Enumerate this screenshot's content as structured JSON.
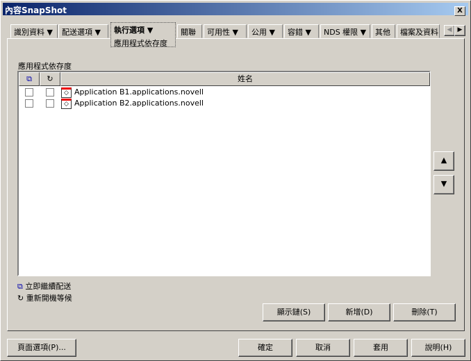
{
  "window": {
    "title": "內容SnapShot",
    "close": "X"
  },
  "tabs": [
    {
      "label": "識別資料 ▼"
    },
    {
      "label": "配送選項 ▼"
    },
    {
      "label": "執行選項",
      "sub": "應用程式依存度"
    },
    {
      "label": "關聯"
    },
    {
      "label": "可用性 ▼"
    },
    {
      "label": "公用 ▼"
    },
    {
      "label": "容錯 ▼"
    },
    {
      "label": "NDS 權限 ▼"
    },
    {
      "label": "其他"
    },
    {
      "label": "檔案及資料"
    }
  ],
  "section_label": "應用程式依存度",
  "list": {
    "column_name": "姓名",
    "rows": [
      {
        "name": "Application B1.applications.novell"
      },
      {
        "name": "Application B2.applications.novell"
      }
    ]
  },
  "legend": {
    "immediate": "立即繼續配送",
    "reboot": "重新開機等候"
  },
  "buttons": {
    "show_chain": "顯示鏈(S)",
    "add": "新增(D)",
    "delete": "刪除(T)",
    "page_options": "頁面選項(P)...",
    "ok": "確定",
    "cancel": "取消",
    "apply": "套用",
    "help": "說明(H)"
  }
}
